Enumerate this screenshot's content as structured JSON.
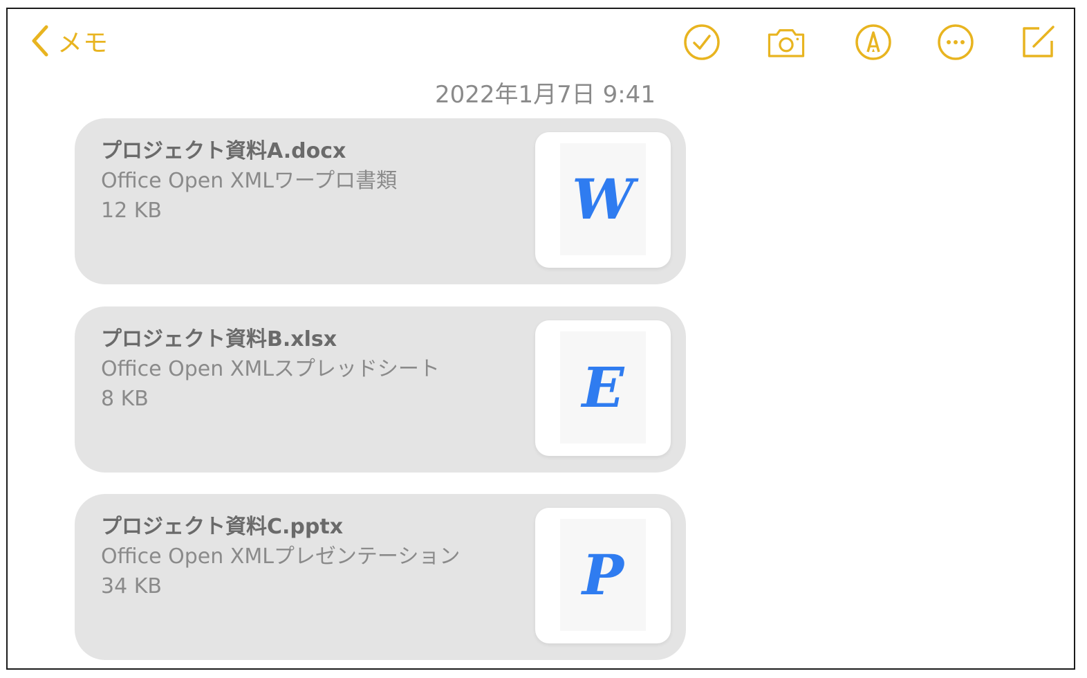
{
  "header": {
    "back_label": "メモ",
    "date": "2022年1月7日 9:41"
  },
  "toolbar": {
    "icons": [
      "checkmark-circle-icon",
      "camera-icon",
      "markup-pen-icon",
      "more-ellipsis-icon",
      "compose-icon"
    ]
  },
  "attachments": [
    {
      "name": "プロジェクト資料A.docx",
      "type": "Office Open XMLワープロ書類",
      "size": "12 KB",
      "letter": "W"
    },
    {
      "name": "プロジェクト資料B.xlsx",
      "type": "Office Open XMLスプレッドシート",
      "size": "8 KB",
      "letter": "E"
    },
    {
      "name": "プロジェクト資料C.pptx",
      "type": "Office Open XMLプレゼンテーション",
      "size": "34 KB",
      "letter": "P"
    }
  ],
  "colors": {
    "accent": "#e8b420",
    "card_bg": "#e4e4e4",
    "doc_letter": "#2f7cf0"
  }
}
